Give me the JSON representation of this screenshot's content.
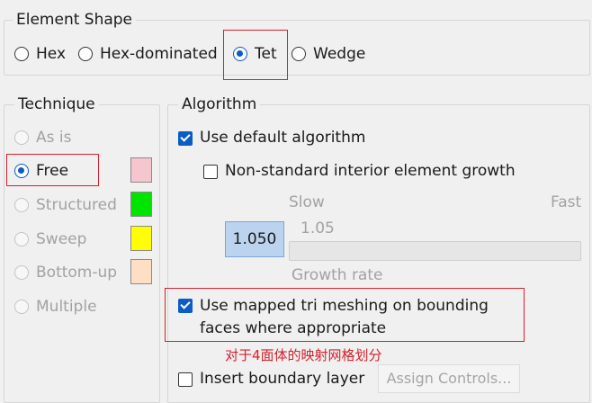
{
  "element_shape": {
    "title": "Element Shape",
    "options": [
      "Hex",
      "Hex-dominated",
      "Tet",
      "Wedge"
    ],
    "selected": "Tet"
  },
  "technique": {
    "title": "Technique",
    "options": [
      {
        "label": "As is",
        "enabled": false,
        "swatch": null
      },
      {
        "label": "Free",
        "enabled": true,
        "swatch": "#f6c6ce"
      },
      {
        "label": "Structured",
        "enabled": false,
        "swatch": "#00e400"
      },
      {
        "label": "Sweep",
        "enabled": false,
        "swatch": "#ffff00"
      },
      {
        "label": "Bottom-up",
        "enabled": false,
        "swatch": "#fde0c4"
      },
      {
        "label": "Multiple",
        "enabled": false,
        "swatch": null
      }
    ],
    "selected": "Free"
  },
  "algorithm": {
    "title": "Algorithm",
    "use_default_label": "Use default algorithm",
    "use_default_checked": true,
    "nonstandard_label": "Non-standard interior element growth",
    "nonstandard_checked": false,
    "slider": {
      "slow_label": "Slow",
      "fast_label": "Fast",
      "min_value_label": "1.05",
      "value": "1.050",
      "caption": "Growth rate"
    },
    "mapped_tri_label_line1": "Use mapped tri meshing on bounding",
    "mapped_tri_label_line2": "faces where appropriate",
    "mapped_tri_checked": true,
    "annotation": "对于4面体的映射网格划分",
    "boundary_layer_label": "Insert boundary layer",
    "boundary_layer_checked": false,
    "assign_controls_label": "Assign Controls..."
  },
  "colors": {
    "accent": "#0b5cc4",
    "highlight_red": "#d3212c"
  }
}
